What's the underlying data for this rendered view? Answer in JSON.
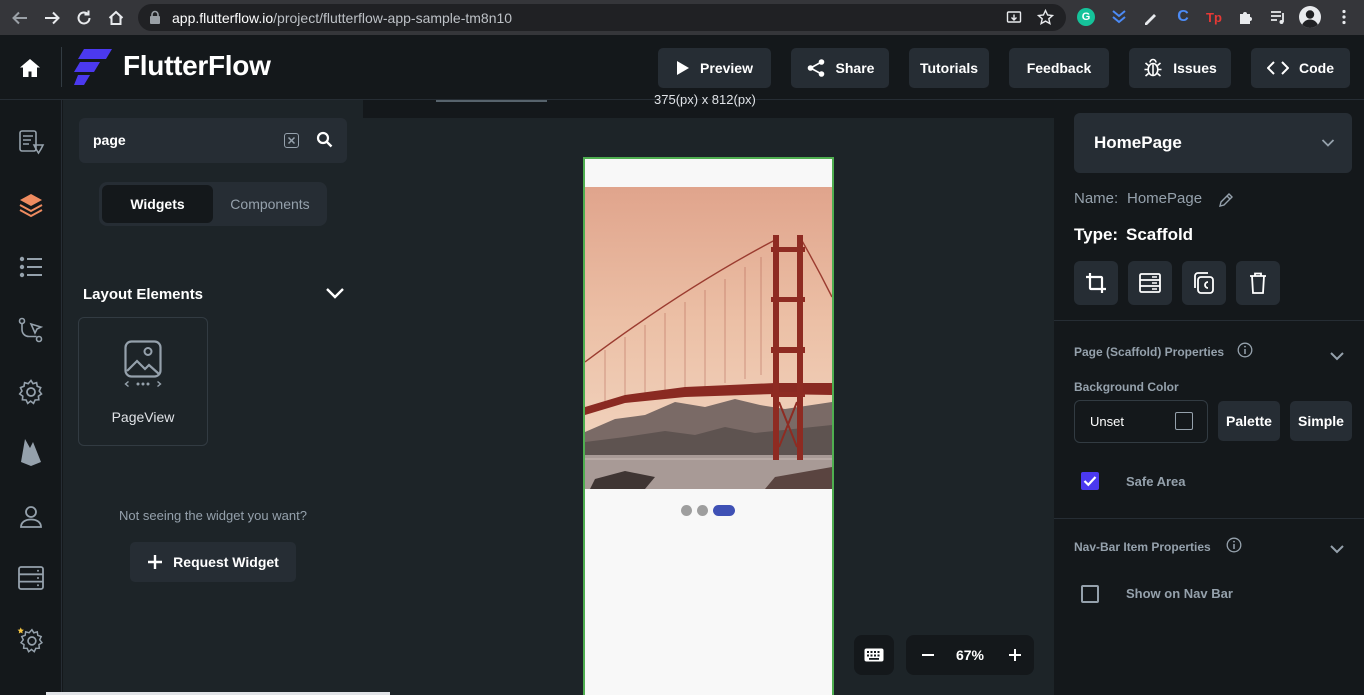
{
  "browser": {
    "url_host": "app.flutterflow.io",
    "url_path": "/project/flutterflow-app-sample-tm8n10",
    "colors": {
      "chrome_bg": "#35363a",
      "omnibox_bg": "#202124"
    }
  },
  "header": {
    "logo_text": "FlutterFlow",
    "buttons": {
      "preview": "Preview",
      "share": "Share",
      "tutorials": "Tutorials",
      "feedback": "Feedback",
      "issues": "Issues",
      "code": "Code"
    }
  },
  "rail": {
    "icons": [
      "home-icon",
      "theme-icon",
      "layers-icon",
      "list-icon",
      "flow-icon",
      "settings-icon",
      "firebase-icon",
      "user-icon",
      "database-icon",
      "api-gear-icon"
    ]
  },
  "widget_panel": {
    "search": {
      "value": "page",
      "placeholder": "Search"
    },
    "tabs": {
      "widgets": "Widgets",
      "components": "Components"
    },
    "section_title": "Layout Elements",
    "card_label": "PageView",
    "prompt": "Not seeing the widget you want?",
    "request_button": "Request Widget"
  },
  "canvas": {
    "size_text": "375(px) x 812(px)",
    "zoom": "67%",
    "page_indicator": {
      "count": 3,
      "active_index": 2
    },
    "colors": {
      "selection_border": "#4fae50",
      "indicator_active": "#3f51b5",
      "indicator_inactive": "#9e9e9e"
    }
  },
  "props": {
    "page_name_title": "HomePage",
    "name_label": "Name:",
    "name_value": "HomePage",
    "type_label": "Type:",
    "type_value": "Scaffold",
    "scaffold_section": "Page (Scaffold) Properties",
    "bg_color_label": "Background Color",
    "bg_color_value": "Unset",
    "palette_button": "Palette",
    "simple_button": "Simple",
    "safe_area_label": "Safe Area",
    "safe_area_checked": true,
    "navbar_section": "Nav-Bar Item Properties",
    "show_navbar_label": "Show on Nav Bar",
    "show_navbar_checked": false,
    "colors": {
      "accent": "#4b39ef",
      "panel_bg": "#14181b",
      "card_bg": "#262d34",
      "muted_text": "#95a1ac"
    }
  }
}
